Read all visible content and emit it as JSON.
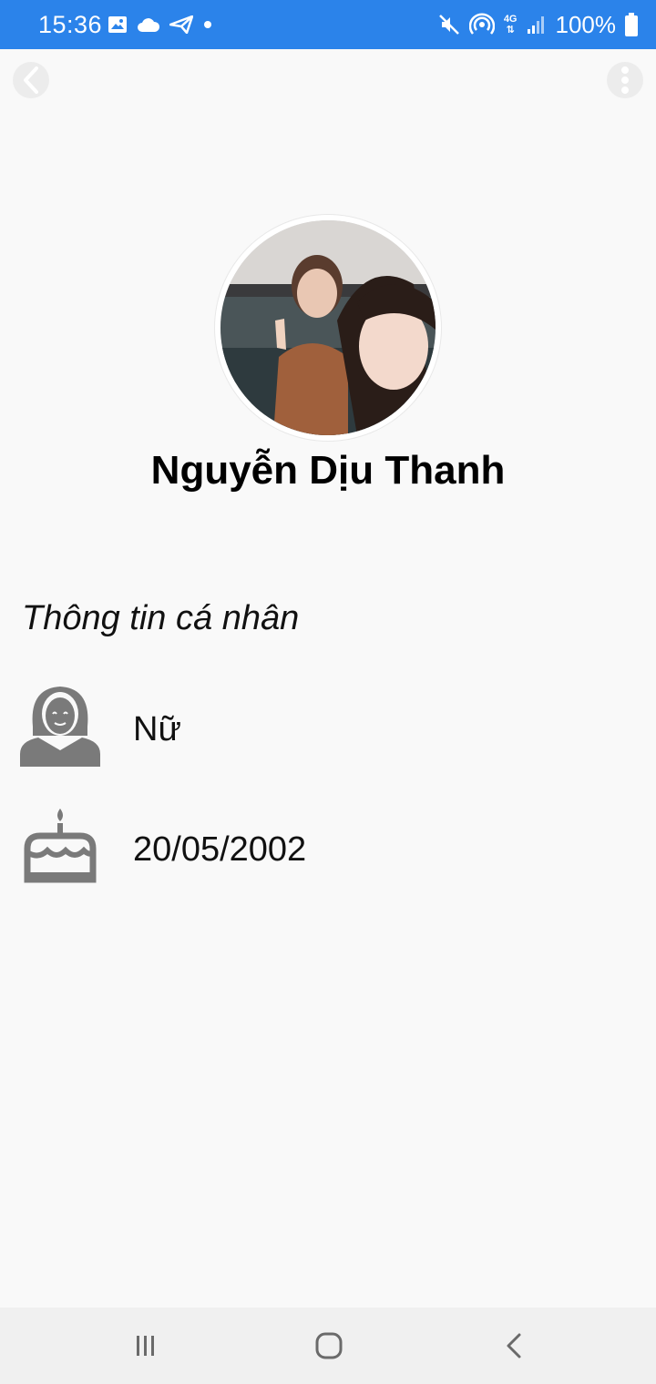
{
  "status_bar": {
    "time": "15:36",
    "left_icons": [
      "image-icon",
      "cloud-icon",
      "send-icon",
      "dot-icon"
    ],
    "right_icons": [
      "mute-icon",
      "hotspot-icon",
      "4g-icon",
      "signal-icon",
      "battery-icon"
    ],
    "network_label": "4G",
    "battery": "100%",
    "colors": {
      "background": "#2b83ea",
      "foreground": "#ffffff"
    }
  },
  "toolbar": {
    "back_icon": "chevron-left-icon",
    "more_icon": "more-vertical-icon"
  },
  "profile": {
    "name": "Nguyễn Dịu Thanh",
    "avatar": "profile-photo"
  },
  "personal_info": {
    "title": "Thông tin cá nhân",
    "gender": {
      "icon": "female-user-icon",
      "value": "Nữ"
    },
    "birthday": {
      "icon": "birthday-cake-icon",
      "value": "20/05/2002"
    }
  },
  "nav_bar": {
    "buttons": [
      "recent-apps-icon",
      "home-icon",
      "back-icon"
    ]
  },
  "colors": {
    "page_background": "#f9f9f9",
    "icon_gray": "#7a7a7a"
  }
}
